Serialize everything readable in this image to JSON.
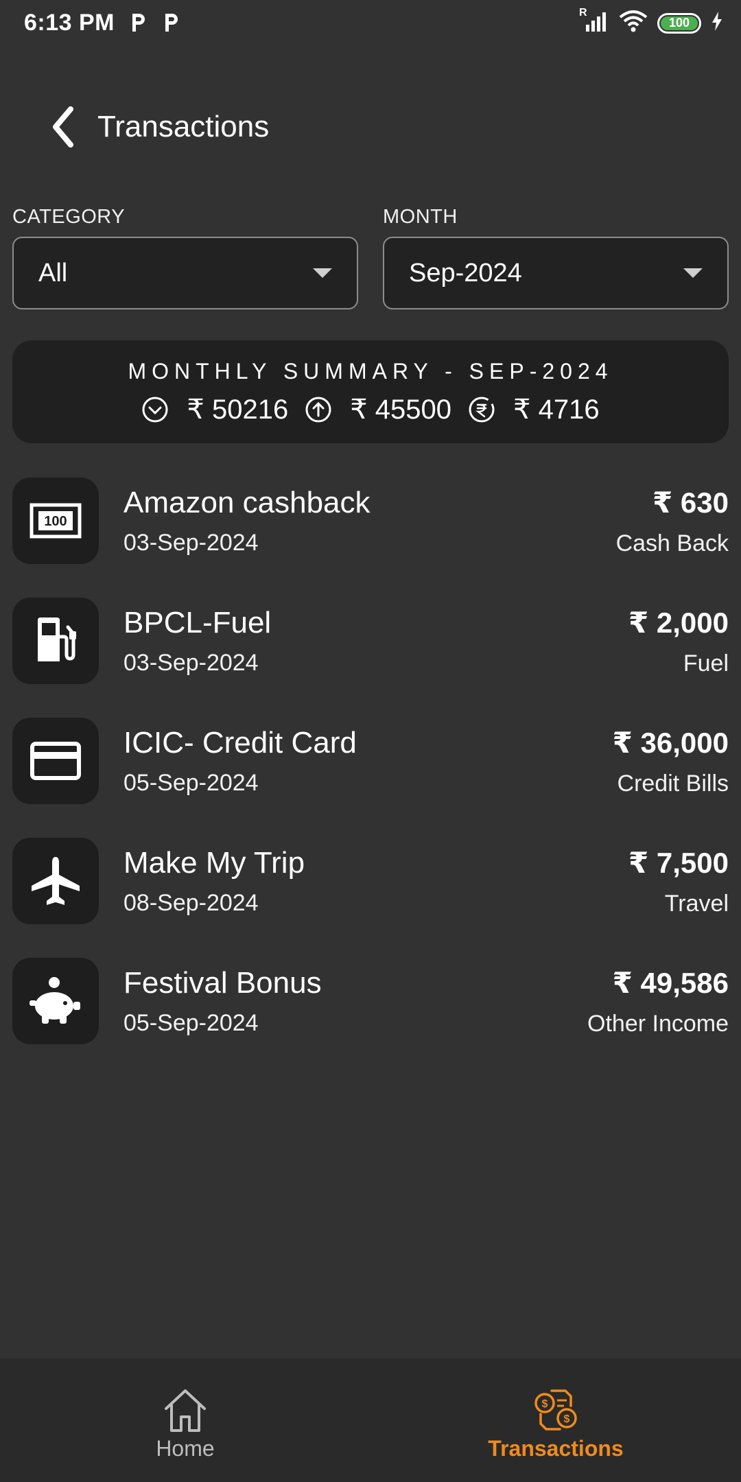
{
  "status_bar": {
    "time": "6:13 PM",
    "battery": "100",
    "signal_label": "R"
  },
  "header": {
    "title": "Transactions"
  },
  "filters": {
    "category_label": "CATEGORY",
    "category_value": "All",
    "month_label": "MONTH",
    "month_value": "Sep-2024"
  },
  "summary": {
    "title": "MONTHLY SUMMARY - SEP-2024",
    "income": "₹ 50216",
    "expense": "₹ 45500",
    "balance": "₹ 4716"
  },
  "transactions": [
    {
      "icon": "cash-note-icon",
      "name": "Amazon cashback",
      "date": "03-Sep-2024",
      "amount": "₹ 630",
      "category": "Cash Back"
    },
    {
      "icon": "fuel-pump-icon",
      "name": "BPCL-Fuel",
      "date": "03-Sep-2024",
      "amount": "₹ 2,000",
      "category": "Fuel"
    },
    {
      "icon": "credit-card-icon",
      "name": "ICIC- Credit Card",
      "date": "05-Sep-2024",
      "amount": "₹ 36,000",
      "category": "Credit Bills"
    },
    {
      "icon": "airplane-icon",
      "name": "Make My Trip",
      "date": "08-Sep-2024",
      "amount": "₹ 7,500",
      "category": "Travel"
    },
    {
      "icon": "piggy-bank-icon",
      "name": "Festival Bonus",
      "date": "05-Sep-2024",
      "amount": "₹ 49,586",
      "category": "Other Income"
    }
  ],
  "cash_note_label": "100",
  "bottom_nav": {
    "home": "Home",
    "transactions": "Transactions"
  },
  "colors": {
    "background": "#323232",
    "card": "#1e1e1e",
    "accent": "#f08b1d"
  }
}
